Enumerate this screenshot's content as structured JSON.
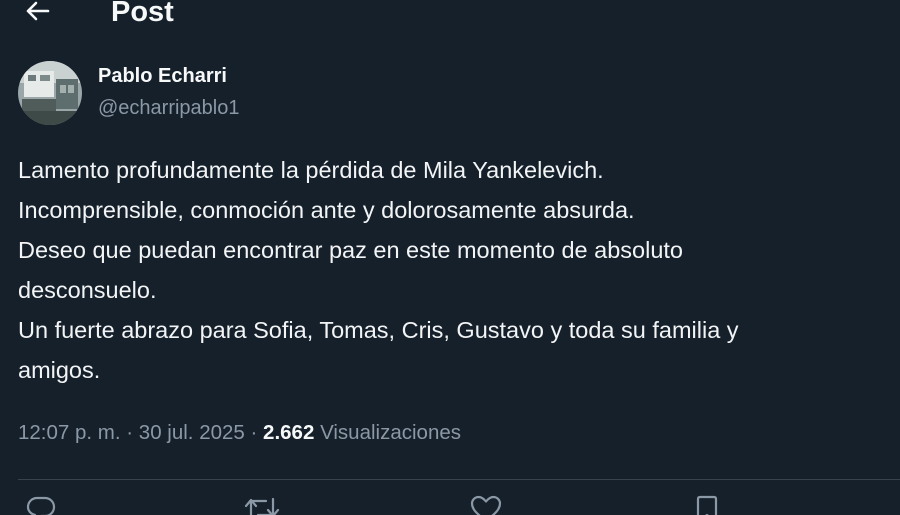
{
  "header": {
    "back_icon": "arrow-left-icon",
    "title": "Post"
  },
  "author": {
    "name": "Pablo Echarri",
    "handle": "@echarripablo1"
  },
  "tweet": {
    "lines": [
      "Lamento profundamente la pérdida de Mila Yankelevich.",
      "Incomprensible, conmoción ante y dolorosamente absurda.",
      "Deseo que puedan encontrar paz en este momento de absoluto",
      "desconsuelo.",
      "Un fuerte abrazo para Sofia, Tomas, Cris, Gustavo y toda su familia y",
      "amigos."
    ]
  },
  "meta": {
    "time": "12:07 p. m.",
    "separator": "·",
    "date": "30 jul. 2025",
    "views_count": "2.662",
    "views_label": "Visualizaciones"
  },
  "actions": {
    "reply_icon": "reply-icon",
    "retweet_icon": "retweet-icon",
    "like_icon": "heart-icon",
    "bookmark_icon": "bookmark-icon"
  },
  "colors": {
    "background": "#15202b",
    "text": "#f7f9f9",
    "muted": "#8b98a5",
    "divider": "#38444d"
  }
}
